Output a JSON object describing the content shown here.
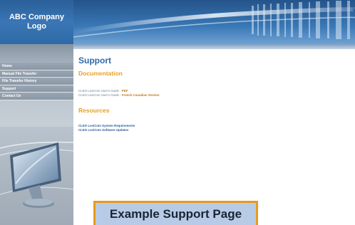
{
  "logo": {
    "line1": "ABC Company",
    "line2": "Logo"
  },
  "nav": {
    "items": [
      {
        "label": "Home"
      },
      {
        "label": "Manual File Transfer"
      },
      {
        "label": "File Transfer History"
      },
      {
        "label": "Support"
      },
      {
        "label": "Contact Us"
      }
    ]
  },
  "page": {
    "title": "Support",
    "documentation": {
      "heading": "Documentation",
      "docs": [
        {
          "prefix": "CLEO LexiCom User's Guide - ",
          "link": "PDF"
        },
        {
          "prefix": "CLEO LexiCom User's Guide - ",
          "link": "French Canadian Version"
        }
      ]
    },
    "resources": {
      "heading": "Resources",
      "links": [
        "CLEO LexiCom System Requirements",
        "CLEO LexiCom Software Updates"
      ]
    }
  },
  "caption": "Example Support Page",
  "colors": {
    "brand_blue": "#2e6aa8",
    "heading_orange": "#e8a020",
    "caption_border": "#e89a1c",
    "caption_fill": "#b8cbe6"
  }
}
